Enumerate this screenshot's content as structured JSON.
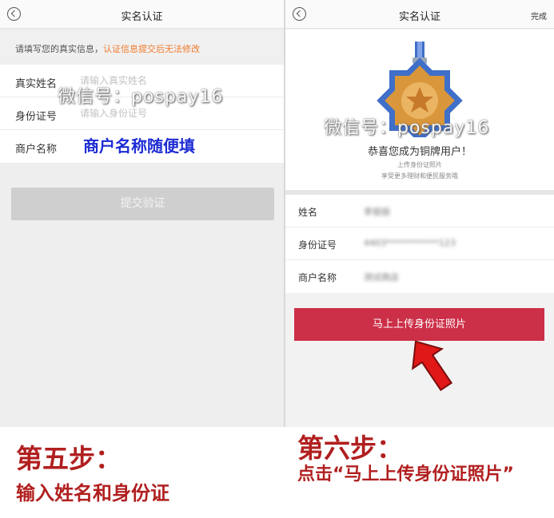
{
  "left": {
    "header_title": "实名认证",
    "notice_prefix": "请填写您的真实信息，",
    "notice_warning": "认证信息提交后无法修改",
    "fields": [
      {
        "label": "真实姓名",
        "placeholder": "请输入真实姓名"
      },
      {
        "label": "身份证号",
        "placeholder": "请输入身份证号"
      },
      {
        "label": "商户名称",
        "placeholder": ""
      }
    ],
    "submit_label": "提交验证",
    "annotation": "商户名称随便填",
    "watermark": "微信号：pospay16"
  },
  "right": {
    "header_title": "实名认证",
    "done_label": "完成",
    "congrats": "恭喜您成为铜牌用户！",
    "sub1": "上传身份证照片",
    "sub2": "享受更多理财和便民服务哦",
    "info": [
      {
        "label": "姓名",
        "value": "李丽丽"
      },
      {
        "label": "身份证号",
        "value": "4403************123"
      },
      {
        "label": "商户名称",
        "value": "测试商店"
      }
    ],
    "upload_label": "马上上传身份证照片",
    "watermark": "微信号：pospay16"
  },
  "captions": {
    "step5_title": "第五步：",
    "step5_text": "输入姓名和身份证",
    "step6_title": "第六步：",
    "step6_text": "点击“马上上传身份证照片”"
  },
  "colors": {
    "warning": "#ef7a2b",
    "upload_button": "#cc2f48",
    "caption": "#b11f1f",
    "annotation": "#1c2bd4"
  }
}
